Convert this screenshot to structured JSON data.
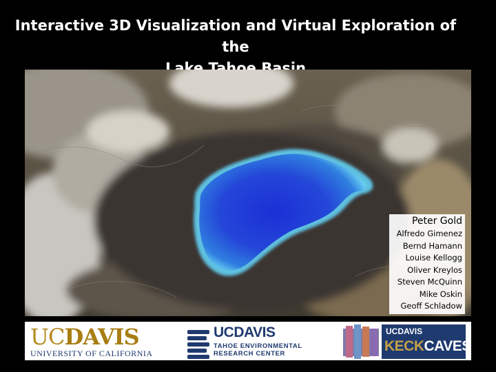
{
  "title": {
    "line1": "Interactive 3D Visualization and Virtual Exploration of the",
    "line2": "Lake Tahoe Basin"
  },
  "authors": {
    "lead": "Peter Gold",
    "names": [
      "Alfredo Gimenez",
      "Bernd Hamann",
      "Louise Kellogg",
      "Oliver Kreylos",
      "Steven McQuinn",
      "Mike Oskin",
      "Geoff Schladow"
    ]
  },
  "logos": {
    "ucdavis": {
      "uc": "UC",
      "davis": "DAVIS",
      "sub": "UNIVERSITY OF CALIFORNIA"
    },
    "terc": {
      "uc": "UC",
      "davis": "DAVIS",
      "line1": "TAHOE ENVIRONMENTAL",
      "line2": "RESEARCH CENTER"
    },
    "keck": {
      "uc": "UC",
      "davis": "DAVIS",
      "keck": "KECK",
      "caves": "CAVES"
    }
  },
  "colors": {
    "background": "#000000",
    "lake_deep": "#1a2fd0",
    "lake_shallow": "#5fd0f0",
    "ucd_gold": "#b38a1d",
    "ucd_blue": "#1f3a6e"
  }
}
